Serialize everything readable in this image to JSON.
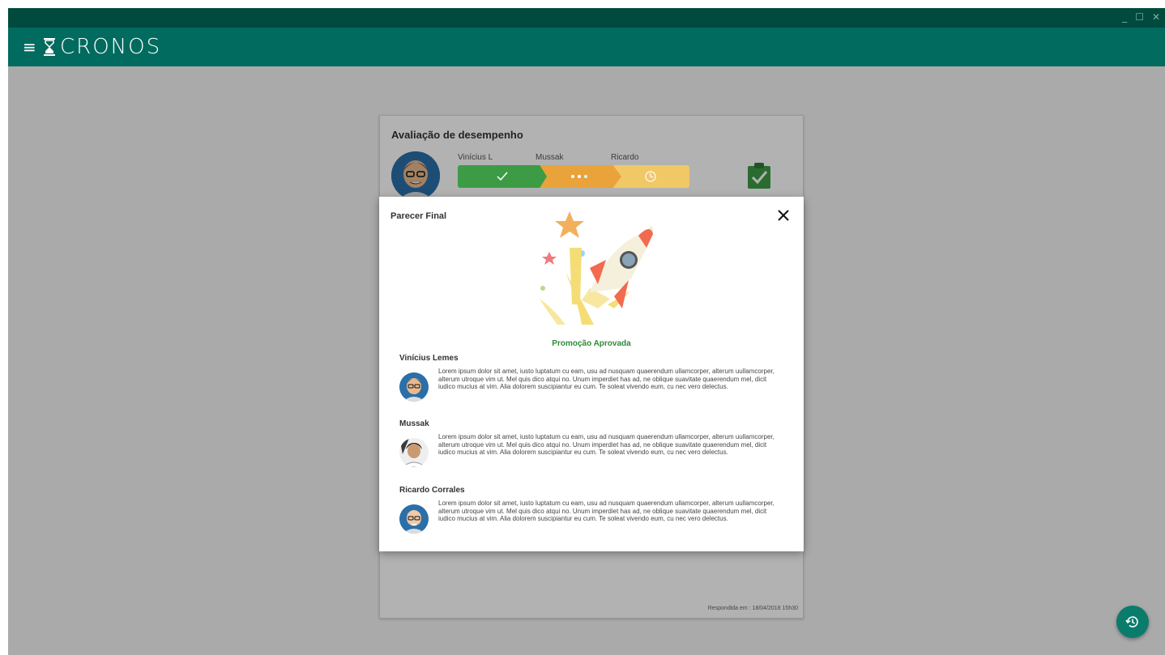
{
  "window": {
    "minimize": "_",
    "maximize": "☐",
    "close": "✕"
  },
  "app": {
    "menu_icon": "hamburger-icon",
    "logo_icon": "hourglass-icon",
    "name": "CRONOS"
  },
  "evaluation": {
    "title": "Avaliação de desempenho",
    "steps": [
      {
        "name": "Vinícius L",
        "status": "done",
        "icon": "check-icon"
      },
      {
        "name": "Mussak",
        "status": "in-progress",
        "icon": "dots-icon"
      },
      {
        "name": "Ricardo",
        "status": "pending",
        "icon": "clock-icon"
      }
    ],
    "status_icon": "clipboard-check-icon",
    "responded": "Respondida em : 18/04/2018 15h30"
  },
  "modal": {
    "title": "Parecer Final",
    "close_icon": "close-icon",
    "illustration": "rocket-icon",
    "result": "Promoção Aprovada",
    "opinions": [
      {
        "name": "Vinícius Lemes",
        "text": "Lorem ipsum dolor sit amet, iusto luptatum cu eam, usu ad nusquam quaerendum ullamcorper, alterum uullamcorper, alterum utroque vim ut. Mel quis dico atqui no. Unum imperdiet has ad, ne oblique suavitate quaerendum mel, dicit iudico mucius at vim. Alia dolorem suscipiantur eu cum. Te soleat vivendo eum, cu nec vero delectus."
      },
      {
        "name": "Mussak",
        "text": "Lorem ipsum dolor sit amet, iusto luptatum cu eam, usu ad nusquam quaerendum ullamcorper, alterum uullamcorper, alterum utroque vim ut. Mel quis dico atqui no. Unum imperdiet has ad, ne oblique suavitate quaerendum mel, dicit iudico mucius at vim. Alia dolorem suscipiantur eu cum. Te soleat vivendo eum, cu nec vero delectus."
      },
      {
        "name": "Ricardo Corrales",
        "text": "Lorem ipsum dolor sit amet, iusto luptatum cu eam, usu ad nusquam quaerendum ullamcorper, alterum uullamcorper, alterum utroque vim ut. Mel quis dico atqui no. Unum imperdiet has ad, ne oblique suavitate quaerendum mel, dicit iudico mucius at vim. Alia dolorem suscipiantur eu cum. Te soleat vivendo eum, cu nec vero delectus."
      }
    ]
  },
  "fab": {
    "icon": "history-icon"
  },
  "colors": {
    "titlebar": "#004a3e",
    "appbar": "#006b5e",
    "success": "#3d9b46",
    "progress": "#e9a33a",
    "pending": "#f0c866",
    "fab": "#0a7c6c"
  }
}
